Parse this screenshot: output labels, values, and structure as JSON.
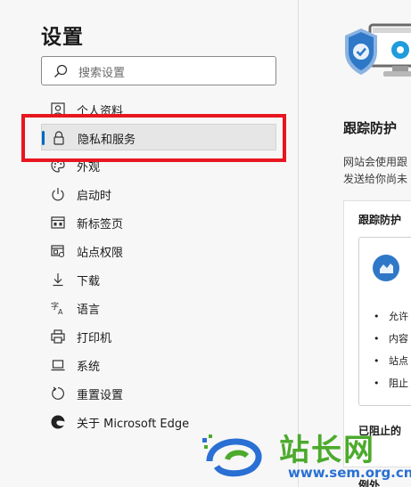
{
  "sidebar": {
    "title": "设置",
    "search_placeholder": "搜索设置",
    "items": [
      {
        "label": "个人资料",
        "icon": "profile-icon"
      },
      {
        "label": "隐私和服务",
        "icon": "lock-icon",
        "active": true
      },
      {
        "label": "外观",
        "icon": "palette-icon"
      },
      {
        "label": "启动时",
        "icon": "power-icon"
      },
      {
        "label": "新标签页",
        "icon": "new-tab-icon"
      },
      {
        "label": "站点权限",
        "icon": "site-permissions-icon"
      },
      {
        "label": "下载",
        "icon": "download-icon"
      },
      {
        "label": "语言",
        "icon": "language-icon"
      },
      {
        "label": "打印机",
        "icon": "printer-icon"
      },
      {
        "label": "系统",
        "icon": "laptop-icon"
      },
      {
        "label": "重置设置",
        "icon": "reset-icon"
      },
      {
        "label": "关于 Microsoft Edge",
        "icon": "edge-logo-icon"
      }
    ]
  },
  "main": {
    "title": "跟踪防护",
    "desc_line1": "网站会使用跟",
    "desc_line2": "发送给你尚未",
    "card_title": "跟踪防护",
    "bullets": [
      "允许",
      "内容",
      "站点",
      "阻止"
    ],
    "blocked_label": "已阻止的",
    "exceptions_label": "例外"
  },
  "watermark": {
    "text": "站长网",
    "url": "www.sem.org.cn"
  },
  "colors": {
    "accent": "#0067c0",
    "highlight": "#e8161f",
    "watermark_green": "#4caa2c",
    "watermark_blue": "#2a6fd4"
  }
}
